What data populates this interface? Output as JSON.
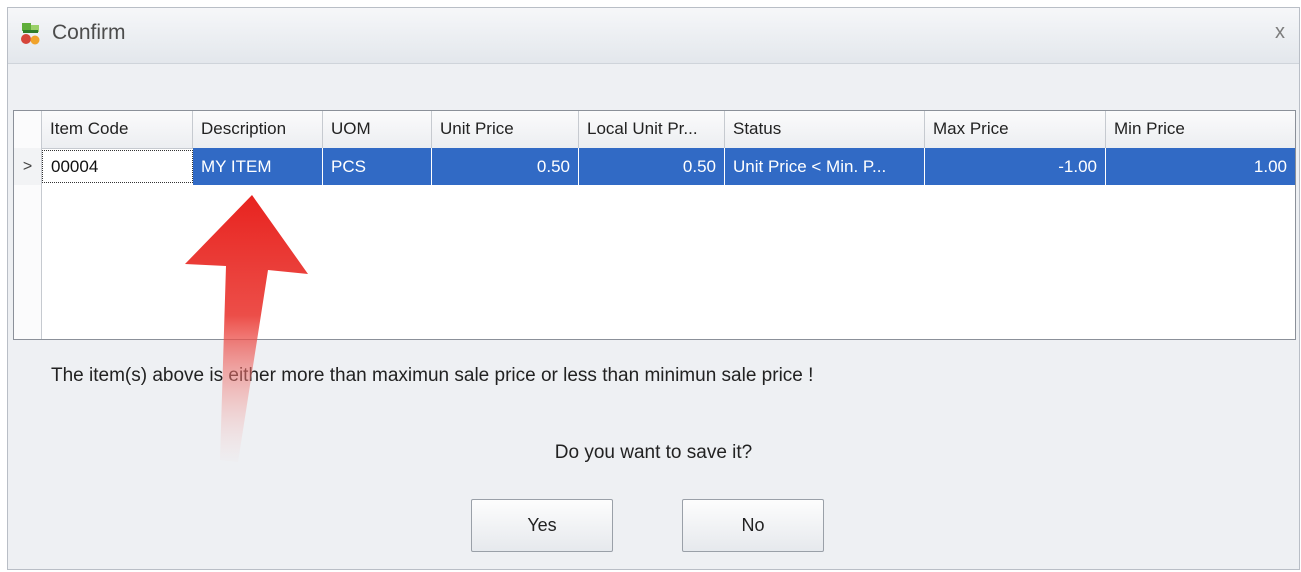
{
  "window": {
    "title": "Confirm",
    "close_glyph": "x"
  },
  "grid": {
    "columns": [
      "Item Code",
      "Description",
      "UOM",
      "Unit Price",
      "Local Unit Pr...",
      "Status",
      "Max Price",
      "Min Price"
    ],
    "rows": [
      {
        "indicator": ">",
        "item_code": "00004",
        "description": "MY ITEM",
        "uom": "PCS",
        "unit_price": "0.50",
        "local_unit_price": "0.50",
        "status": "Unit Price < Min. P...",
        "max_price": "-1.00",
        "min_price": "1.00"
      }
    ]
  },
  "message": "The item(s) above is either more than maximun sale price or less than minimun sale price !",
  "question": "Do you want to save it?",
  "buttons": {
    "yes": "Yes",
    "no": "No"
  },
  "colors": {
    "selection": "#316ac5",
    "annotation_arrow": "#e8231f"
  },
  "icons": {
    "app": "app-icon",
    "close": "close-icon",
    "row_indicator": "chevron-right-icon",
    "annotation": "red-arrow-annotation"
  }
}
